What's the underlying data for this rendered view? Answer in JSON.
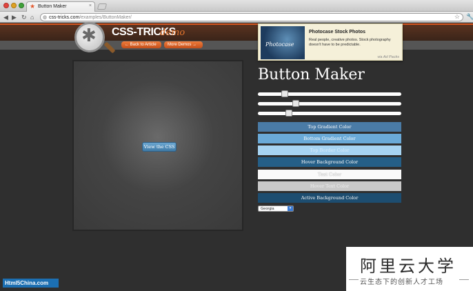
{
  "browser": {
    "tab_title": "Button Maker",
    "tab_close": "×",
    "url_domain": "css-tricks.com",
    "url_path": "/examples/ButtonMaker/"
  },
  "icons": {
    "back": "back-arrow-icon",
    "forward": "forward-arrow-icon",
    "reload": "reload-icon",
    "home": "home-icon",
    "globe": "globe-icon",
    "star": "bookmark-star-icon",
    "wrench": "wrench-icon",
    "favicon": "star-favicon-icon"
  },
  "site": {
    "logo_text": "CSS-TRICKS",
    "logo_demo": "demo",
    "back_link": "← Back to Article",
    "more_link": "More Demos →"
  },
  "ad": {
    "image_text": "Photocase",
    "title": "Photocase Stock Photos",
    "body": "Real people, creative photos. Stock photography doesn't have to be predictable.",
    "via": "via Ad Packs"
  },
  "preview": {
    "button_label": "View the CSS"
  },
  "controls": {
    "heading": "Button Maker",
    "sliders": [
      {
        "value_fraction": 0.17
      },
      {
        "value_fraction": 0.25
      },
      {
        "value_fraction": 0.2
      }
    ],
    "color_buttons": [
      {
        "label": "Top Gradient Color",
        "color": "#4a7ba6"
      },
      {
        "label": "Bottom Gradient Color",
        "color": "#6aaad8"
      },
      {
        "label": "Top Border Color",
        "color": "#a7d4f2"
      },
      {
        "label": "Hover Background Color",
        "color": "#255f87"
      },
      {
        "label": "Text Color",
        "color": "#fafafa"
      },
      {
        "label": "Hover Text Color",
        "color": "#c9c9c9"
      },
      {
        "label": "Active Background Color",
        "color": "#1d4d70"
      }
    ],
    "font_select": "Georgia"
  },
  "watermarks": {
    "left": "Html5China.com",
    "right_title": "阿里云大学",
    "right_subtitle": "云生态下的创新人才工场"
  }
}
